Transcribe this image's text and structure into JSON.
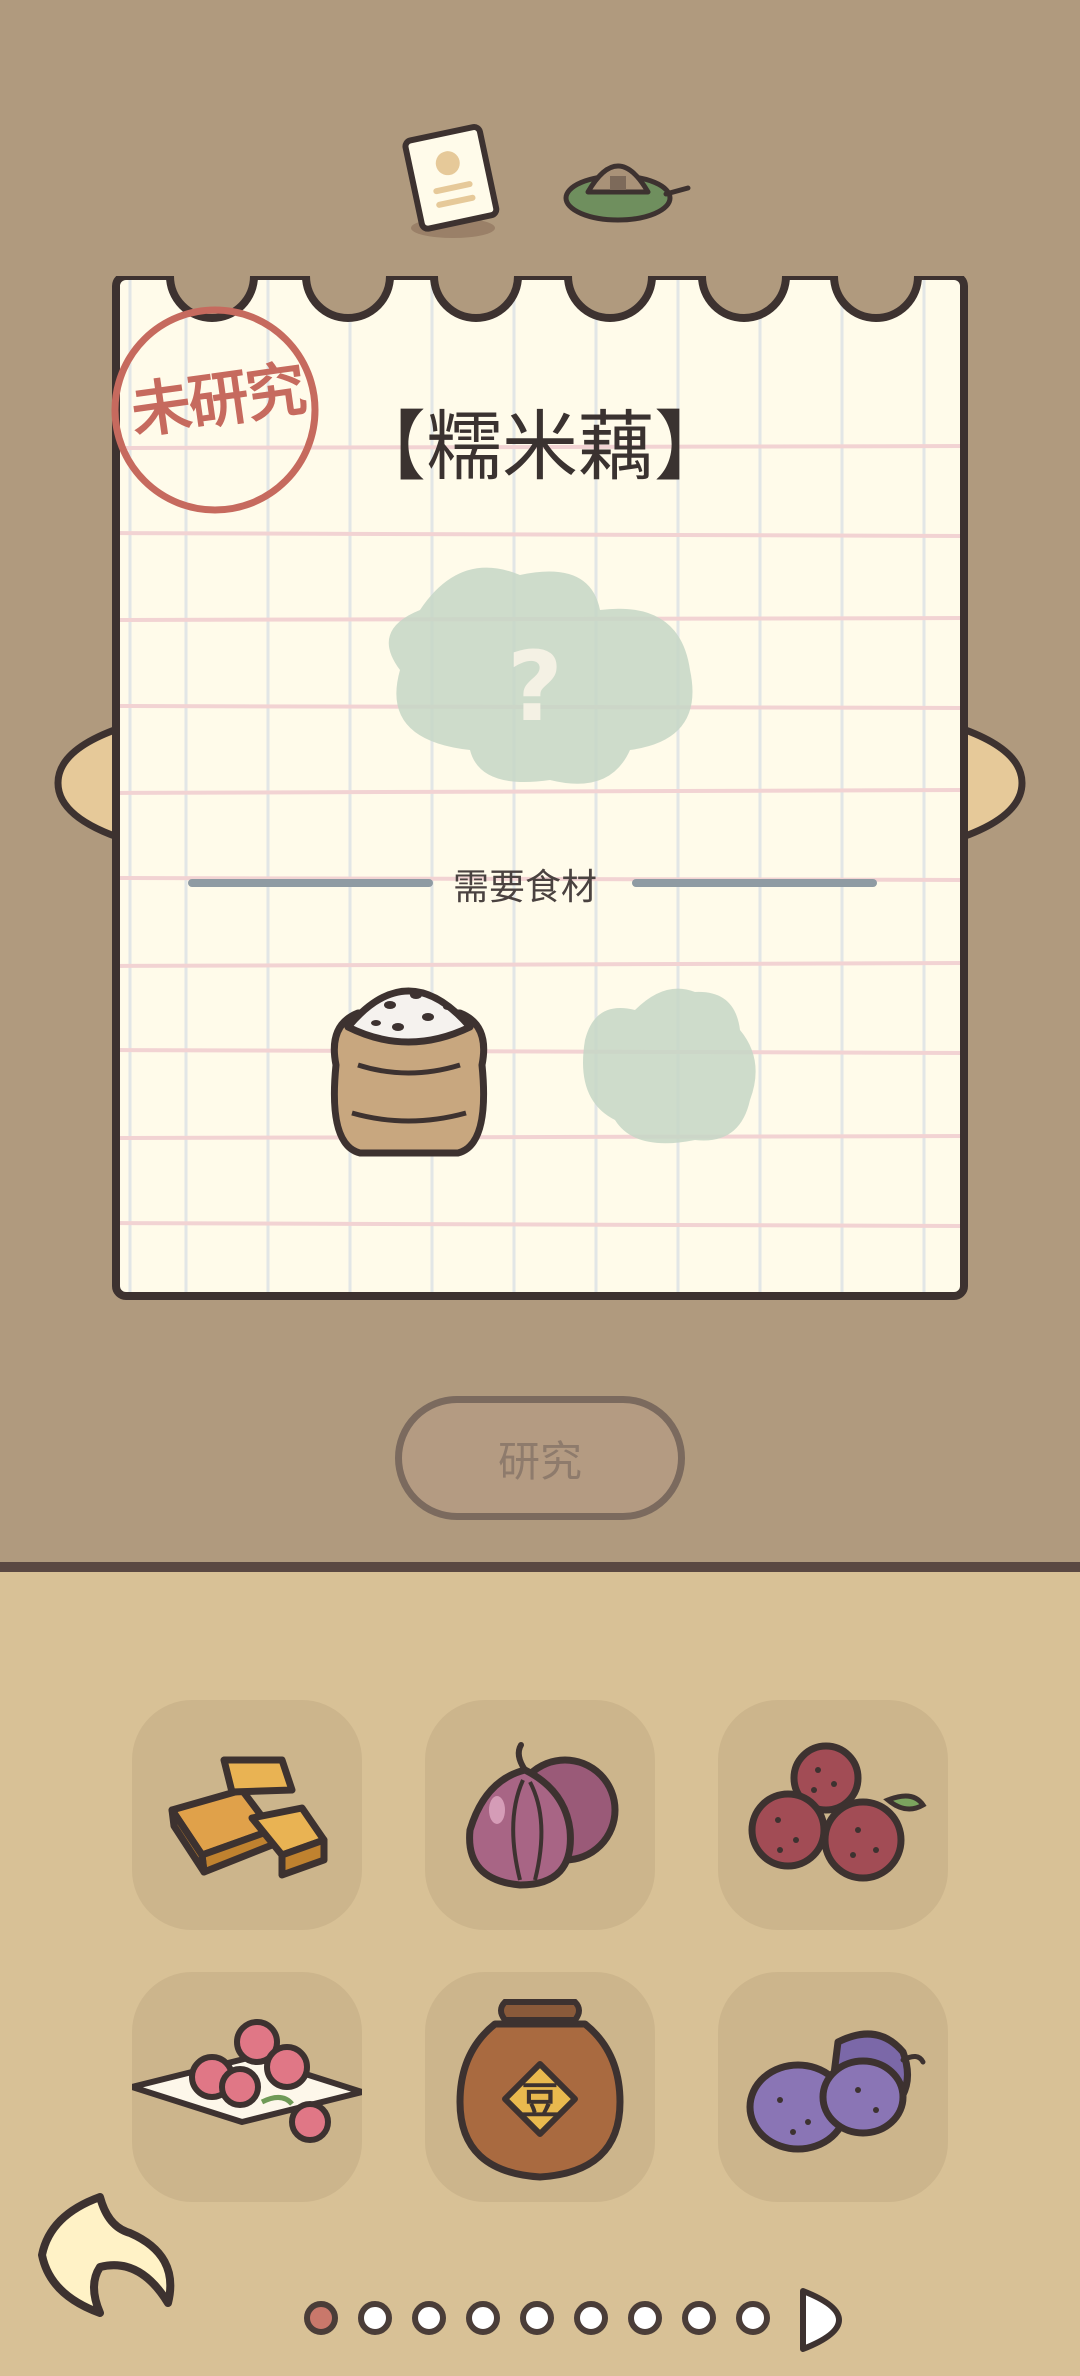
{
  "notebook": {
    "status_stamp": "未研究",
    "dish_name": "【糯米藕】",
    "mystery_glyph": "?",
    "ingredients_label": "需要食材"
  },
  "actions": {
    "research_label": "研究"
  },
  "inventory": {
    "items": [
      {
        "name": "tofu-cake-icon"
      },
      {
        "name": "red-onion-icon"
      },
      {
        "name": "bayberry-icon"
      },
      {
        "name": "rose-petals-icon"
      },
      {
        "name": "bean-paste-jar-icon"
      },
      {
        "name": "taro-icon"
      }
    ],
    "jar_label": "豆"
  },
  "pagination": {
    "total_dots": 9,
    "current_page": 1
  },
  "colors": {
    "background": "#b09a7e",
    "paper": "#fffbea",
    "panel": "#d8c196",
    "stamp_red": "#c66a5e",
    "accent_beige": "#e6c999"
  }
}
